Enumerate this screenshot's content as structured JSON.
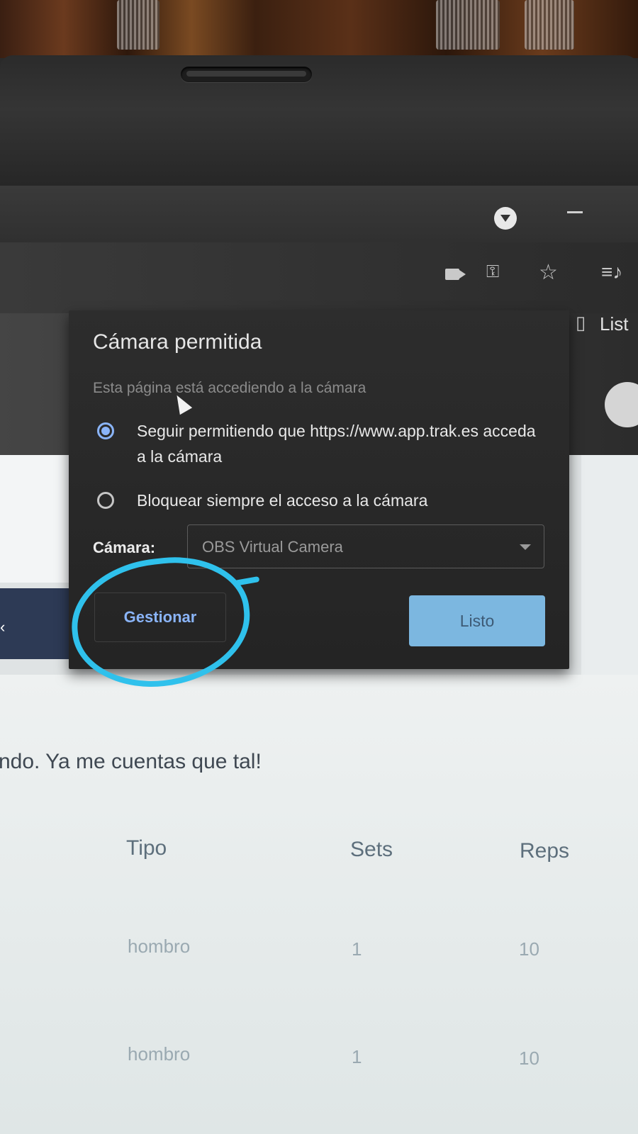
{
  "popup": {
    "title": "Cámara permitida",
    "subtitle": "Esta página está accediendo a la cámara",
    "option_allow": "Seguir permitiendo que https://www.app.trak.es acceda a la cámara",
    "option_block": "Bloquear siempre el acceso a la cámara",
    "selected_option": "allow",
    "camera_label": "Cámara:",
    "camera_value": "OBS Virtual Camera",
    "manage_button": "Gestionar",
    "done_button": "Listo"
  },
  "toolbar": {
    "side_panel_label": "List",
    "icons": [
      "profile-dropdown-icon",
      "minimize-icon",
      "camera-icon",
      "key-icon",
      "star-icon",
      "playlist-icon",
      "close-icon",
      "side-panel-icon",
      "avatar-icon"
    ]
  },
  "page": {
    "message": "ndo. Ya me cuentas que tal!",
    "table": {
      "headers": [
        "Tipo",
        "Sets",
        "Reps"
      ],
      "rows": [
        [
          "hombro",
          "1",
          "10"
        ],
        [
          "hombro",
          "1",
          "10"
        ]
      ]
    }
  },
  "colors": {
    "annotation": "#2fc1ec",
    "accent_blue": "#8ab4f8",
    "done_button": "#7cb7e0"
  }
}
